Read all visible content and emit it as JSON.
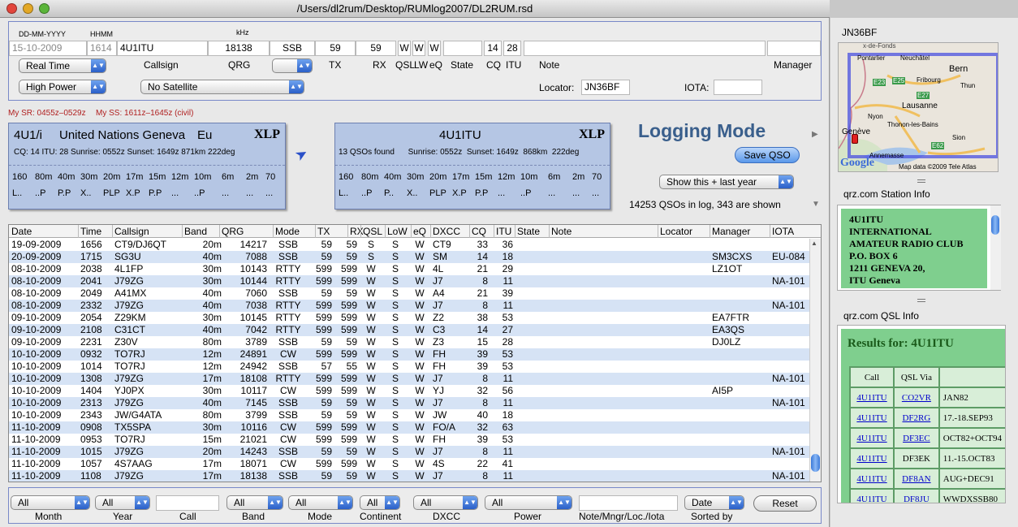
{
  "window": {
    "title": "/Users/dl2rum/Desktop/RUMlog2007/DL2RUM.rsd"
  },
  "entry": {
    "hdr_date_fmt": "DD-MM-YYYY",
    "hdr_time_fmt": "HHMM",
    "hdr_khz": "kHz",
    "date": "15-10-2009",
    "time": "1614",
    "callsign": "4U1ITU",
    "qrg": "18138",
    "mode": "SSB",
    "tx": "59",
    "rx": "59",
    "qsl": "W",
    "lw": "W",
    "eq": "W",
    "state": "",
    "cq": "14",
    "itu": "28",
    "note": "",
    "manager": "",
    "time_mode": "Real Time",
    "power": "High Power",
    "satellite": "No Satellite",
    "mode_select": "",
    "labels": {
      "callsign": "Callsign",
      "qrg": "QRG",
      "tx": "TX",
      "rx": "RX",
      "qsl": "QSL",
      "lw": "LW",
      "eq": "eQ",
      "state": "State",
      "cq": "CQ",
      "itu": "ITU",
      "note": "Note",
      "manager": "Manager",
      "locator": "Locator:",
      "iota": "IOTA:"
    },
    "locator": "JN36BF",
    "iota": ""
  },
  "sun_info": {
    "sr": "My SR: 0455z–0529z",
    "ss": "My SS: 1611z–1645z (civil)"
  },
  "entity_card": {
    "prefix": "4U1/i",
    "name": "United Nations Geneva",
    "continent": "Eu",
    "badge": "XLP",
    "info": "CQ: 14   ITU: 28  Sunrise: 0552z  Sunset: 1649z  871km  222deg",
    "bands": [
      "160",
      "80m",
      "40m",
      "30m",
      "20m",
      "17m",
      "15m",
      "12m",
      "10m",
      "6m",
      "2m",
      "70"
    ],
    "status": [
      "L..",
      "..P",
      "P.P",
      "X..",
      "PLP",
      "X.P",
      "P.P",
      "...",
      "..P",
      "...",
      "...",
      "..."
    ]
  },
  "call_card": {
    "call": "4U1ITU",
    "badge": "XLP",
    "info": "13 QSOs found      Sunrise: 0552z  Sunset: 1649z  868km  222deg",
    "bands": [
      "160",
      "80m",
      "40m",
      "30m",
      "20m",
      "17m",
      "15m",
      "12m",
      "10m",
      "6m",
      "2m",
      "70"
    ],
    "status": [
      "L..",
      "..P",
      "P..",
      "X..",
      "PLP",
      "X.P",
      "P.P",
      "...",
      "..P",
      "...",
      "...",
      "..."
    ]
  },
  "logging": {
    "mode_label": "Logging Mode",
    "save_button": "Save QSO",
    "filter": "Show this + last year",
    "count_text": "14253 QSOs in log, 343 are shown"
  },
  "log_table": {
    "columns": [
      "Date",
      "Time",
      "Callsign",
      "Band",
      "QRG",
      "Mode",
      "TX",
      "RX",
      "QSL",
      "LoW",
      "eQ",
      "DXCC",
      "CQ",
      "ITU",
      "State",
      "Note",
      "Locator",
      "Manager",
      "IOTA"
    ],
    "rows": [
      [
        "19-09-2009",
        "1656",
        "CT9/DJ6QT",
        "20m",
        "14217",
        "SSB",
        "59",
        "59",
        "S",
        "S",
        "W",
        "CT9",
        "33",
        "36",
        "",
        "",
        "",
        "",
        ""
      ],
      [
        "20-09-2009",
        "1715",
        "SG3U",
        "40m",
        "7088",
        "SSB",
        "59",
        "59",
        "S",
        "S",
        "W",
        "SM",
        "14",
        "18",
        "",
        "",
        "",
        "SM3CXS",
        "EU-084"
      ],
      [
        "08-10-2009",
        "2038",
        "4L1FP",
        "30m",
        "10143",
        "RTTY",
        "599",
        "599",
        "W",
        "S",
        "W",
        "4L",
        "21",
        "29",
        "",
        "",
        "",
        "LZ1OT",
        ""
      ],
      [
        "08-10-2009",
        "2041",
        "J79ZG",
        "30m",
        "10144",
        "RTTY",
        "599",
        "599",
        "W",
        "S",
        "W",
        "J7",
        "8",
        "11",
        "",
        "",
        "",
        "",
        "NA-101"
      ],
      [
        "08-10-2009",
        "2049",
        "A41MX",
        "40m",
        "7060",
        "SSB",
        "59",
        "59",
        "W",
        "S",
        "W",
        "A4",
        "21",
        "39",
        "",
        "",
        "",
        "",
        ""
      ],
      [
        "08-10-2009",
        "2332",
        "J79ZG",
        "40m",
        "7038",
        "RTTY",
        "599",
        "599",
        "W",
        "S",
        "W",
        "J7",
        "8",
        "11",
        "",
        "",
        "",
        "",
        "NA-101"
      ],
      [
        "09-10-2009",
        "2054",
        "Z29KM",
        "30m",
        "10145",
        "RTTY",
        "599",
        "599",
        "W",
        "S",
        "W",
        "Z2",
        "38",
        "53",
        "",
        "",
        "",
        "EA7FTR",
        ""
      ],
      [
        "09-10-2009",
        "2108",
        "C31CT",
        "40m",
        "7042",
        "RTTY",
        "599",
        "599",
        "W",
        "S",
        "W",
        "C3",
        "14",
        "27",
        "",
        "",
        "",
        "EA3QS",
        ""
      ],
      [
        "09-10-2009",
        "2231",
        "Z30V",
        "80m",
        "3789",
        "SSB",
        "59",
        "59",
        "W",
        "S",
        "W",
        "Z3",
        "15",
        "28",
        "",
        "",
        "",
        "DJ0LZ",
        ""
      ],
      [
        "10-10-2009",
        "0932",
        "TO7RJ",
        "12m",
        "24891",
        "CW",
        "599",
        "599",
        "W",
        "S",
        "W",
        "FH",
        "39",
        "53",
        "",
        "",
        "",
        "",
        ""
      ],
      [
        "10-10-2009",
        "1014",
        "TO7RJ",
        "12m",
        "24942",
        "SSB",
        "57",
        "55",
        "W",
        "S",
        "W",
        "FH",
        "39",
        "53",
        "",
        "",
        "",
        "",
        ""
      ],
      [
        "10-10-2009",
        "1308",
        "J79ZG",
        "17m",
        "18108",
        "RTTY",
        "599",
        "599",
        "W",
        "S",
        "W",
        "J7",
        "8",
        "11",
        "",
        "",
        "",
        "",
        "NA-101"
      ],
      [
        "10-10-2009",
        "1404",
        "YJ0PX",
        "30m",
        "10117",
        "CW",
        "599",
        "599",
        "W",
        "S",
        "W",
        "YJ",
        "32",
        "56",
        "",
        "",
        "",
        "AI5P",
        ""
      ],
      [
        "10-10-2009",
        "2313",
        "J79ZG",
        "40m",
        "7145",
        "SSB",
        "59",
        "59",
        "W",
        "S",
        "W",
        "J7",
        "8",
        "11",
        "",
        "",
        "",
        "",
        "NA-101"
      ],
      [
        "10-10-2009",
        "2343",
        "JW/G4ATA",
        "80m",
        "3799",
        "SSB",
        "59",
        "59",
        "W",
        "S",
        "W",
        "JW",
        "40",
        "18",
        "",
        "",
        "",
        "",
        ""
      ],
      [
        "11-10-2009",
        "0908",
        "TX5SPA",
        "30m",
        "10116",
        "CW",
        "599",
        "599",
        "W",
        "S",
        "W",
        "FO/A",
        "32",
        "63",
        "",
        "",
        "",
        "",
        ""
      ],
      [
        "11-10-2009",
        "0953",
        "TO7RJ",
        "15m",
        "21021",
        "CW",
        "599",
        "599",
        "W",
        "S",
        "W",
        "FH",
        "39",
        "53",
        "",
        "",
        "",
        "",
        ""
      ],
      [
        "11-10-2009",
        "1015",
        "J79ZG",
        "20m",
        "14243",
        "SSB",
        "59",
        "59",
        "W",
        "S",
        "W",
        "J7",
        "8",
        "11",
        "",
        "",
        "",
        "",
        "NA-101"
      ],
      [
        "11-10-2009",
        "1057",
        "4S7AAG",
        "17m",
        "18071",
        "CW",
        "599",
        "599",
        "W",
        "S",
        "W",
        "4S",
        "22",
        "41",
        "",
        "",
        "",
        "",
        ""
      ],
      [
        "11-10-2009",
        "1108",
        "J79ZG",
        "17m",
        "18138",
        "SSB",
        "59",
        "59",
        "W",
        "S",
        "W",
        "J7",
        "8",
        "11",
        "",
        "",
        "",
        "",
        "NA-101"
      ]
    ]
  },
  "filters": {
    "month": "All",
    "year": "All",
    "call": "",
    "band": "All",
    "mode": "All",
    "continent": "All",
    "dxcc": "All",
    "power": "All",
    "note": "",
    "sort": "Date",
    "reset": "Reset",
    "labels": {
      "month": "Month",
      "year": "Year",
      "call": "Call",
      "band": "Band",
      "mode": "Mode",
      "continent": "Continent",
      "dxcc": "DXCC",
      "power": "Power",
      "note": "Note/Mngr/Loc./Iota",
      "sort": "Sorted by"
    }
  },
  "map": {
    "locator": "JN36BF",
    "cities": [
      "Pontarlier",
      "Neuchâtel",
      "Bern",
      "Fribourg",
      "Thun",
      "Lausanne",
      "Nyon",
      "Thonon-les-Bains",
      "Genève",
      "Annemasse",
      "Sion"
    ],
    "roads": [
      "E23",
      "E25",
      "E27",
      "E62"
    ],
    "credit": "Map data ©2009 Tele Atlas",
    "logo": "Google",
    "top_fragment": "x-de-Fonds"
  },
  "station_info": {
    "title": "qrz.com Station Info",
    "lines": [
      "4U1ITU",
      "INTERNATIONAL",
      "AMATEUR RADIO CLUB",
      "P.O. BOX 6",
      "1211 GENEVA 20,",
      "ITU Geneva"
    ]
  },
  "qsl_info": {
    "title": "qrz.com QSL Info",
    "results": "Results for: 4U1ITU",
    "headers": [
      "Call",
      "QSL Via",
      ""
    ],
    "rows": [
      [
        "4U1ITU",
        "CO2VR",
        "JAN82"
      ],
      [
        "4U1ITU",
        "DF2RG",
        "17.-18.SEP93"
      ],
      [
        "4U1ITU",
        "DF3EC",
        "OCT82+OCT94"
      ],
      [
        "4U1ITU",
        "DF3EK",
        "11.-15.OCT83"
      ],
      [
        "4U1ITU",
        "DF8AN",
        "AUG+DEC91"
      ],
      [
        "4U1ITU",
        "DF8JU",
        "WWDXSSB80"
      ]
    ]
  }
}
